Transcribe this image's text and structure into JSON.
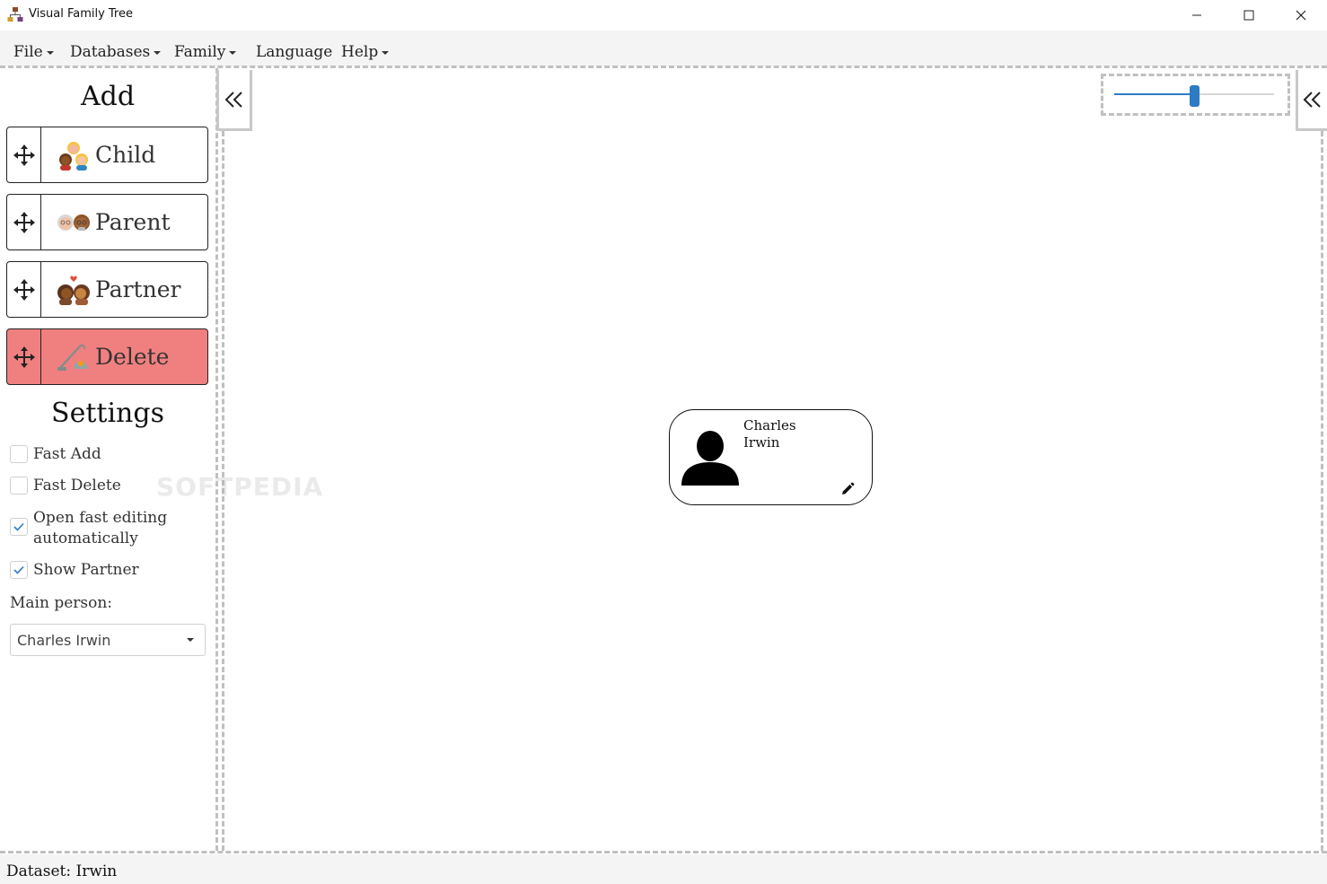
{
  "window": {
    "title": "Visual Family Tree",
    "controls": [
      "minimize",
      "maximize",
      "close"
    ]
  },
  "menu": {
    "items": [
      {
        "label": "File",
        "has_dropdown": true
      },
      {
        "label": "Databases",
        "has_dropdown": true
      },
      {
        "label": "Family",
        "has_dropdown": true
      },
      {
        "label": "Language",
        "has_dropdown": false
      },
      {
        "label": "Help",
        "has_dropdown": true
      }
    ]
  },
  "add_panel": {
    "title": "Add",
    "buttons": [
      {
        "label": "Child",
        "icon": "children-emoji-icon"
      },
      {
        "label": "Parent",
        "icon": "grandparents-emoji-icon"
      },
      {
        "label": "Partner",
        "icon": "kissing-couple-emoji-icon"
      },
      {
        "label": "Delete",
        "icon": "vacuum-cleaner-emoji-icon",
        "color": "#f08080"
      }
    ]
  },
  "settings": {
    "title": "Settings",
    "options": [
      {
        "label": "Fast Add",
        "checked": false
      },
      {
        "label": "Fast Delete",
        "checked": false
      },
      {
        "label": "Open fast editing automatically",
        "checked": true
      },
      {
        "label": "Show Partner",
        "checked": true
      }
    ],
    "main_person_label": "Main person:",
    "main_person_value": "Charles Irwin"
  },
  "canvas": {
    "zoom_level": 0.5,
    "accent_color": "#2d7bc4",
    "person_card": {
      "first_name": "Charles",
      "last_name": "Irwin",
      "avatar_icon": "person-silhouette-icon",
      "edit_icon": "pencil-icon"
    },
    "watermark": "SOFTPEDIA"
  },
  "status": {
    "text": "Dataset: Irwin"
  }
}
